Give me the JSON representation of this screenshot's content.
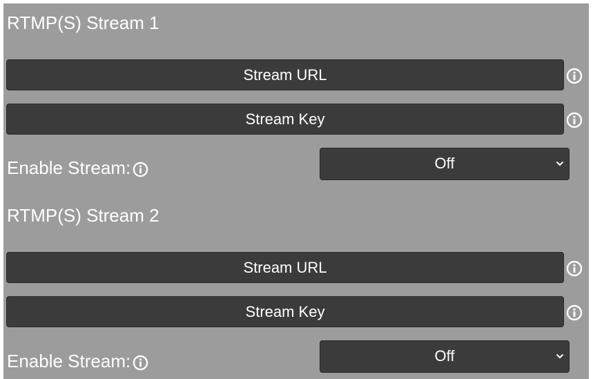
{
  "streams": [
    {
      "title": "RTMP(S) Stream 1",
      "url_placeholder": "Stream URL",
      "url_value": "",
      "key_placeholder": "Stream Key",
      "key_value": "",
      "enable_label": "Enable Stream:",
      "enable_value": "Off"
    },
    {
      "title": "RTMP(S) Stream 2",
      "url_placeholder": "Stream URL",
      "url_value": "",
      "key_placeholder": "Stream Key",
      "key_value": "",
      "enable_label": "Enable Stream:",
      "enable_value": "Off"
    }
  ],
  "icons": {
    "info": "info-icon",
    "dropdown": "chevron-down-icon"
  },
  "colors": {
    "panel_background": "#9c9c9c",
    "field_background": "#3b3b3b",
    "text": "#ffffff"
  }
}
